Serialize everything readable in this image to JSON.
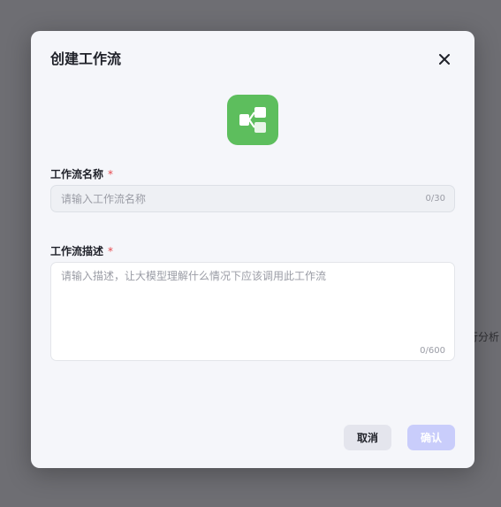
{
  "background": {
    "partial_text": "行分析"
  },
  "dialog": {
    "title": "创建工作流",
    "close_icon": "close-icon",
    "app_icon": "workflow-icon",
    "icon_color": "#5dbe5d",
    "name_field": {
      "label": "工作流名称",
      "required_mark": "*",
      "placeholder": "请输入工作流名称",
      "value": "",
      "counter": "0/30"
    },
    "description_field": {
      "label": "工作流描述",
      "required_mark": "*",
      "placeholder": "请输入描述，让大模型理解什么情况下应该调用此工作流",
      "value": "",
      "counter": "0/600"
    },
    "cancel_label": "取消",
    "confirm_label": "确认",
    "confirm_color": "#c9cdfb"
  }
}
